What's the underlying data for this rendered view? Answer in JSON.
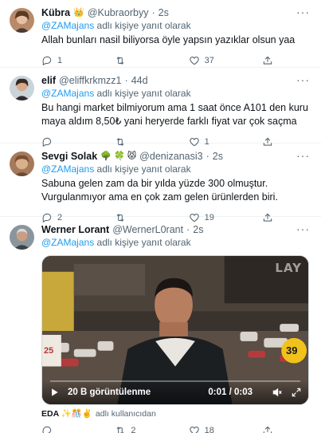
{
  "tweets": [
    {
      "name": "Kübra",
      "name_emoji": "👑",
      "handle": "@Kubraorbyy",
      "dot": "·",
      "time": "2s",
      "reply_prefix": "",
      "reply_mention": "@ZAMajans",
      "reply_suffix": "adlı kişiye yanıt olarak",
      "text": "Allah bunları nasil biliyorsa öyle yapsın yazıklar olsun yaa",
      "reply_count": "1",
      "retweet_count": "",
      "like_count": "37"
    },
    {
      "name": "elif",
      "handle": "@eliffkrkmzz1",
      "dot": "·",
      "time": "44d",
      "reply_mention": "@ZAMajans",
      "reply_suffix": "adlı kişiye yanıt olarak",
      "text": "Bu hangi market bilmiyorum ama 1 saat önce A101 den kuru maya aldım 8,50₺  yani heryerde farklı fiyat var çok saçma",
      "reply_count": "",
      "retweet_count": "",
      "like_count": "1"
    },
    {
      "name": "Sevgi Solak",
      "name_emoji": "🌳 🍀 😾",
      "handle": "@denizanasi3",
      "dot": "·",
      "time": "2s",
      "reply_mention": "@ZAMajans",
      "reply_suffix": "adlı kişiye yanıt olarak",
      "text": "Sabuna gelen zam da bir yılda yüzde 300 olmuştur. Vurgulanmıyor ama en çok zam gelen ürünlerden biri.",
      "reply_count": "2",
      "retweet_count": "",
      "like_count": "19"
    },
    {
      "name": "Werner Lorant",
      "handle": "@WernerL0rant",
      "dot": "·",
      "time": "2s",
      "reply_mention": "@ZAMajans",
      "reply_suffix": "adlı kişiye yanıt olarak",
      "video": {
        "views": "20 B görüntülenme",
        "time": "0:01 / 0:03",
        "logo": "LAY",
        "sign_number": "39",
        "left_sign": "25"
      },
      "footnote_name": "EDA ✨🎊✌️",
      "footnote_text": "adlı kullanıcıdan",
      "reply_count": "",
      "retweet_count": "2",
      "like_count": "18"
    }
  ],
  "icons": {
    "more": "more-icon",
    "reply": "reply-icon",
    "retweet": "retweet-icon",
    "like": "heart-icon",
    "share": "share-icon"
  },
  "colors": {
    "accent": "#1d9bf0",
    "muted": "#536471",
    "text": "#0f1419",
    "border": "#eff3f4"
  }
}
